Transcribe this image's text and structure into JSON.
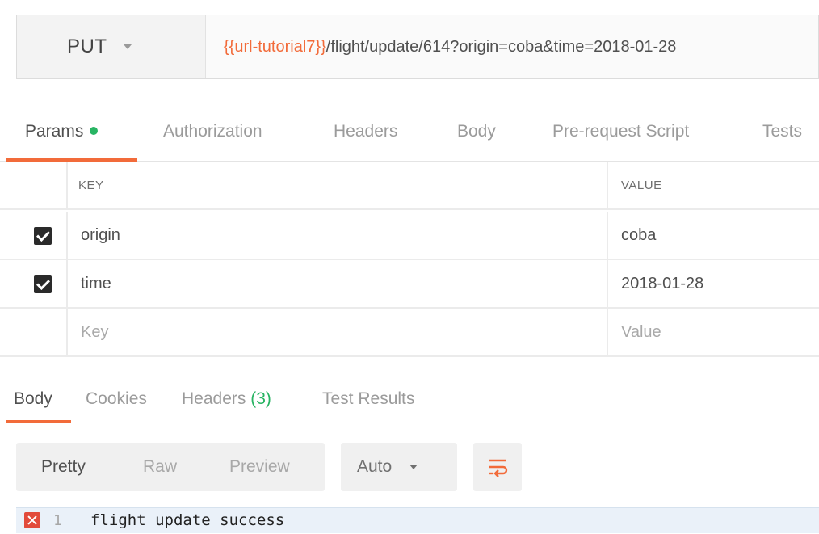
{
  "request": {
    "method": "PUT",
    "url_variable": "{{url-tutorial7}}",
    "url_path": "/flight/update/614?origin=coba&time=2018-01-28"
  },
  "request_tabs": [
    {
      "label": "Params",
      "active": true,
      "indicator": true
    },
    {
      "label": "Authorization"
    },
    {
      "label": "Headers"
    },
    {
      "label": "Body"
    },
    {
      "label": "Pre-request Script"
    },
    {
      "label": "Tests"
    }
  ],
  "params": {
    "key_header": "KEY",
    "value_header": "VALUE",
    "rows": [
      {
        "key": "origin",
        "value": "coba",
        "checked": true
      },
      {
        "key": "time",
        "value": "2018-01-28",
        "checked": true
      }
    ],
    "key_placeholder": "Key",
    "value_placeholder": "Value"
  },
  "response_tabs": [
    {
      "label": "Body",
      "active": true
    },
    {
      "label": "Cookies"
    },
    {
      "label": "Headers",
      "count": "(3)"
    },
    {
      "label": "Test Results"
    }
  ],
  "body_toolbar": {
    "views": [
      "Pretty",
      "Raw",
      "Preview"
    ],
    "active_view": "Pretty",
    "format": "Auto",
    "wrap_icon": "wrap-lines-icon"
  },
  "response_body": {
    "line_number": "1",
    "text": "flight update success",
    "line_marker": "error-icon"
  },
  "colors": {
    "accent": "#f26b3a",
    "success": "#28b463",
    "error": "#e24b3b"
  }
}
